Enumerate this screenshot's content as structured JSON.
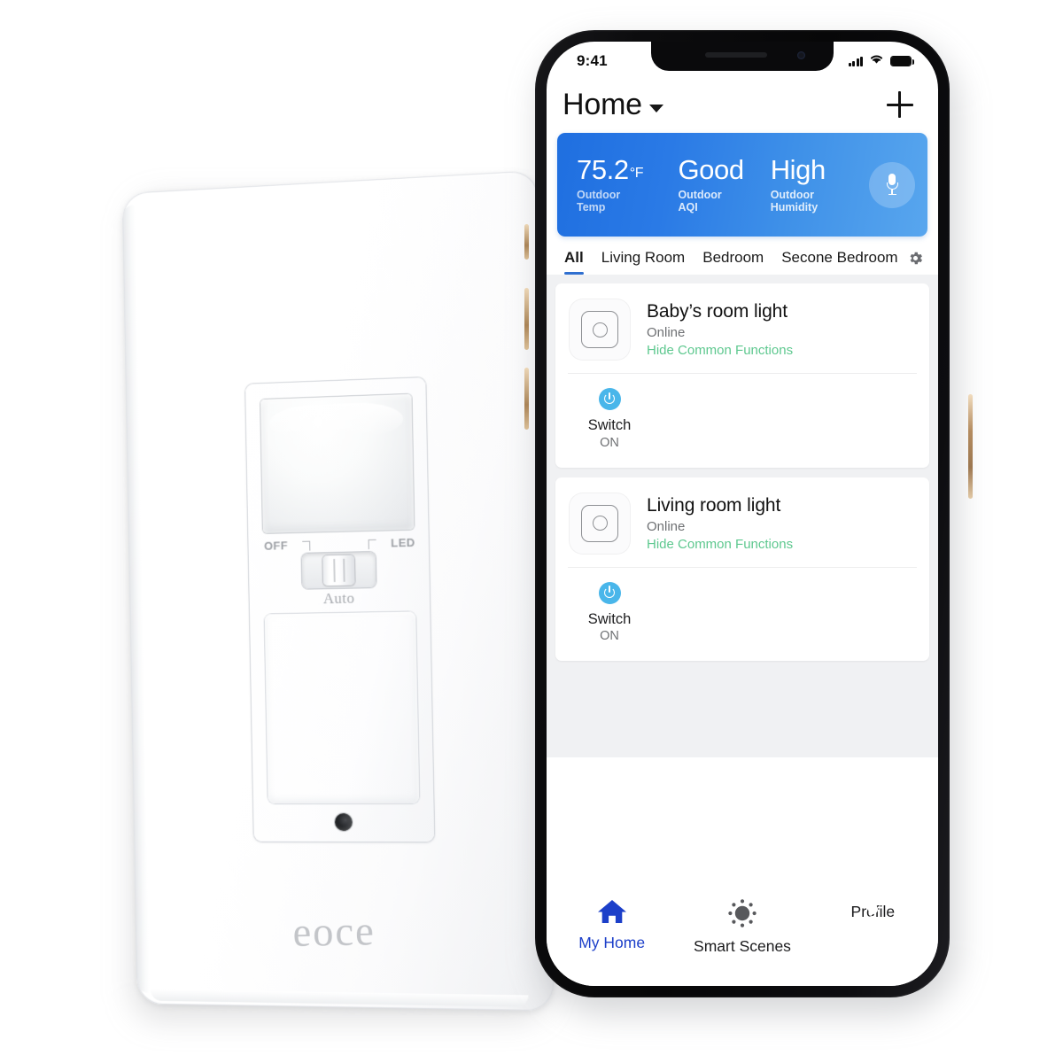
{
  "product": {
    "brand": "eoce",
    "mode_labels": {
      "off": "OFF",
      "led": "LED",
      "auto": "Auto"
    }
  },
  "phone": {
    "status_bar": {
      "time": "9:41",
      "signal_icon": "cellular-signal-icon",
      "wifi_icon": "wifi-icon",
      "battery_icon": "battery-full-icon"
    },
    "header": {
      "title": "Home",
      "chevron_icon": "chevron-down-icon",
      "add_icon": "plus-icon"
    },
    "weather_banner": {
      "accent_from": "#1f6fe0",
      "accent_to": "#58a6ee",
      "stats": [
        {
          "value": "75.2",
          "unit": "°F",
          "label": "Outdoor Temp"
        },
        {
          "value": "Good",
          "unit": "",
          "label": "Outdoor AQI"
        },
        {
          "value": "High",
          "unit": "",
          "label": "Outdoor Humidity"
        }
      ],
      "mic_icon": "microphone-icon"
    },
    "tabs": {
      "items": [
        {
          "label": "All",
          "active": true
        },
        {
          "label": "Living Room",
          "active": false
        },
        {
          "label": "Bedroom",
          "active": false
        },
        {
          "label": "Secone Bedroom",
          "active": false
        }
      ],
      "settings_icon": "gear-icon",
      "active_underline_color": "#2f6fd0"
    },
    "devices": [
      {
        "name": "Baby’s room light",
        "status": "Online",
        "link": "Hide Common Functions",
        "link_color": "#5ec88f",
        "device_icon": "switch-device-icon",
        "functions": [
          {
            "icon": "power-icon",
            "name": "Switch",
            "state": "ON",
            "color": "#49b6ea"
          }
        ]
      },
      {
        "name": "Living room light",
        "status": "Online",
        "link": "Hide Common Functions",
        "link_color": "#5ec88f",
        "device_icon": "switch-device-icon",
        "functions": [
          {
            "icon": "power-icon",
            "name": "Switch",
            "state": "ON",
            "color": "#49b6ea"
          }
        ]
      }
    ],
    "bottom_nav": {
      "active_color": "#1c3fc9",
      "items": [
        {
          "label": "My Home",
          "icon": "home-icon",
          "active": true
        },
        {
          "label": "Smart Scenes",
          "icon": "sun-burst-icon",
          "active": false
        },
        {
          "label": "Profile",
          "icon": "user-avatar-icon",
          "active": false
        }
      ]
    }
  }
}
